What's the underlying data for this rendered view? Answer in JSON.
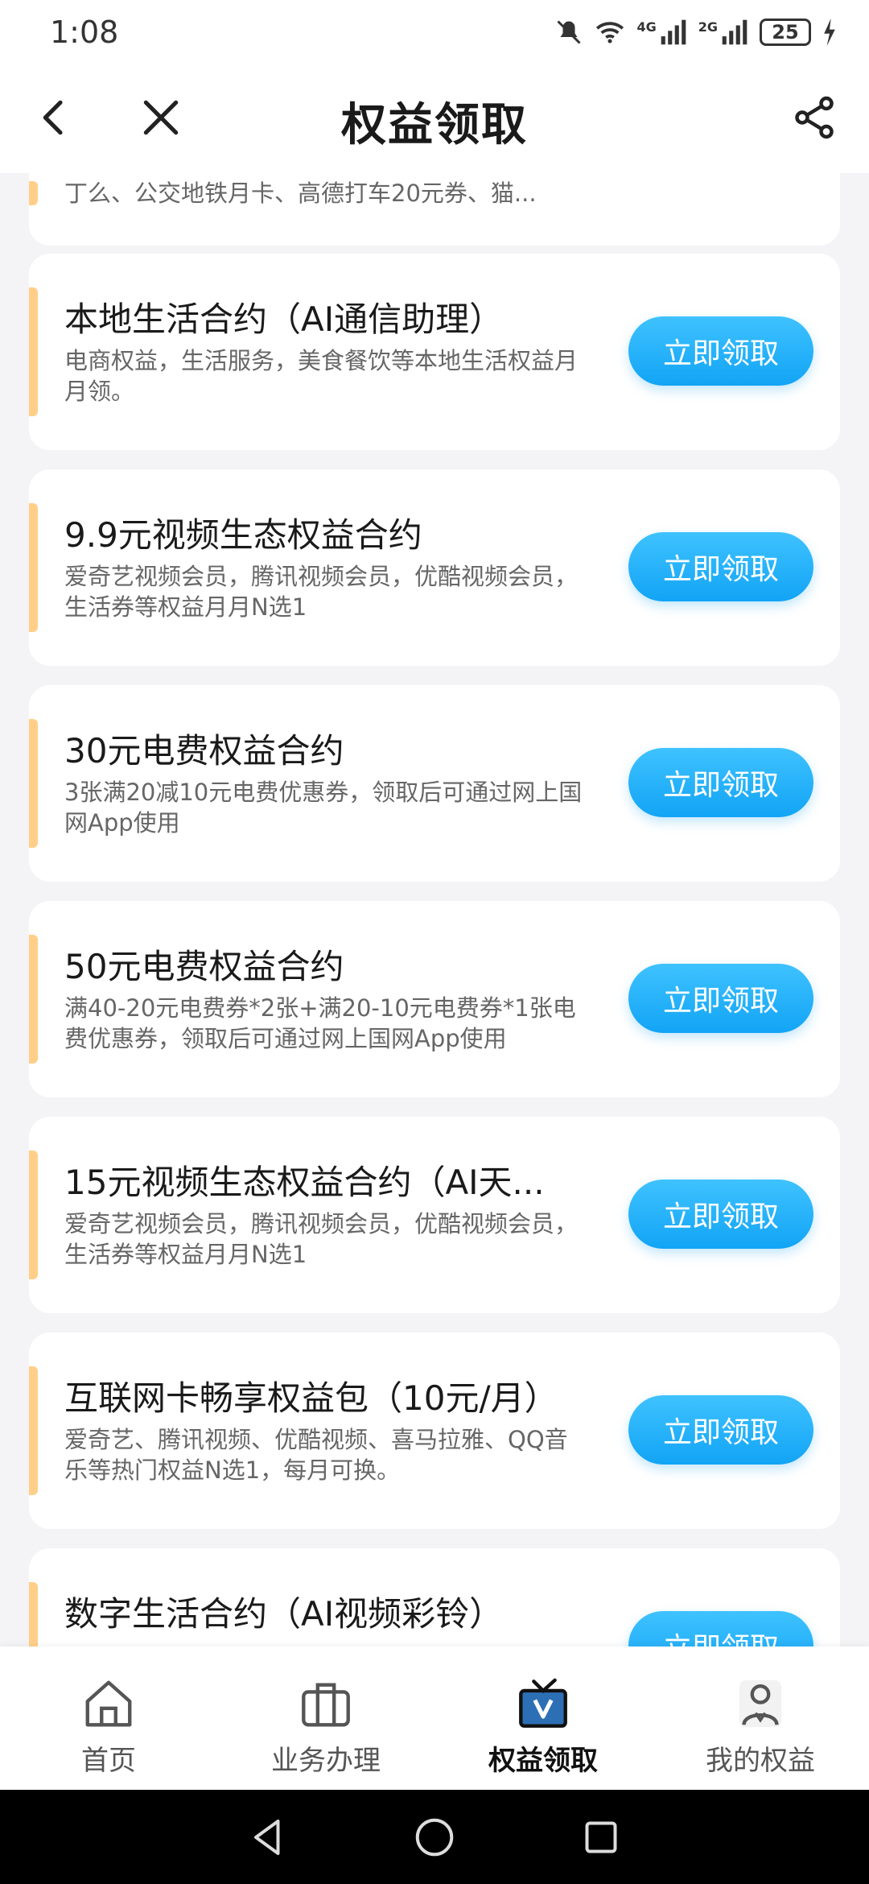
{
  "status_bar": {
    "time": "1:08",
    "network_1": "4G",
    "network_2": "2G",
    "battery": "25"
  },
  "header": {
    "title": "权益领取"
  },
  "cards": [
    {
      "title": "",
      "desc": "丁么、公交地铁月卡、高德打车20元券、猫...",
      "button": ""
    },
    {
      "title": "本地生活合约（AI通信助理）",
      "desc": "电商权益，生活服务，美食餐饮等本地生活权益月月领。",
      "button": "立即领取"
    },
    {
      "title": "9.9元视频生态权益合约",
      "desc": "爱奇艺视频会员，腾讯视频会员，优酷视频会员，生活券等权益月月N选1",
      "button": "立即领取"
    },
    {
      "title": "30元电费权益合约",
      "desc": "3张满20减10元电费优惠券，领取后可通过网上国网App使用",
      "button": "立即领取"
    },
    {
      "title": "50元电费权益合约",
      "desc": "满40-20元电费券*2张+满20-10元电费券*1张电费优惠券，领取后可通过网上国网App使用",
      "button": "立即领取"
    },
    {
      "title": "15元视频生态权益合约（AI天...",
      "desc": "爱奇艺视频会员，腾讯视频会员，优酷视频会员，生活券等权益月月N选1",
      "button": "立即领取"
    },
    {
      "title": "互联网卡畅享权益包（10元/月）",
      "desc": "爱奇艺、腾讯视频、优酷视频、喜马拉雅、QQ音乐等热门权益N选1，每月可换。",
      "button": "立即领取"
    },
    {
      "title": "数字生活合约（AI视频彩铃）",
      "desc": "",
      "button": "立即领取"
    }
  ],
  "bottom_nav": [
    {
      "label": "首页",
      "icon": "home-icon",
      "active": false
    },
    {
      "label": "业务办理",
      "icon": "briefcase-icon",
      "active": false
    },
    {
      "label": "权益领取",
      "icon": "tv-icon",
      "active": true
    },
    {
      "label": "我的权益",
      "icon": "user-icon",
      "active": false
    }
  ],
  "colors": {
    "accent_button": "#1aaaf7",
    "card_accent": "#ffcf8a",
    "background": "#f4f4f6"
  }
}
